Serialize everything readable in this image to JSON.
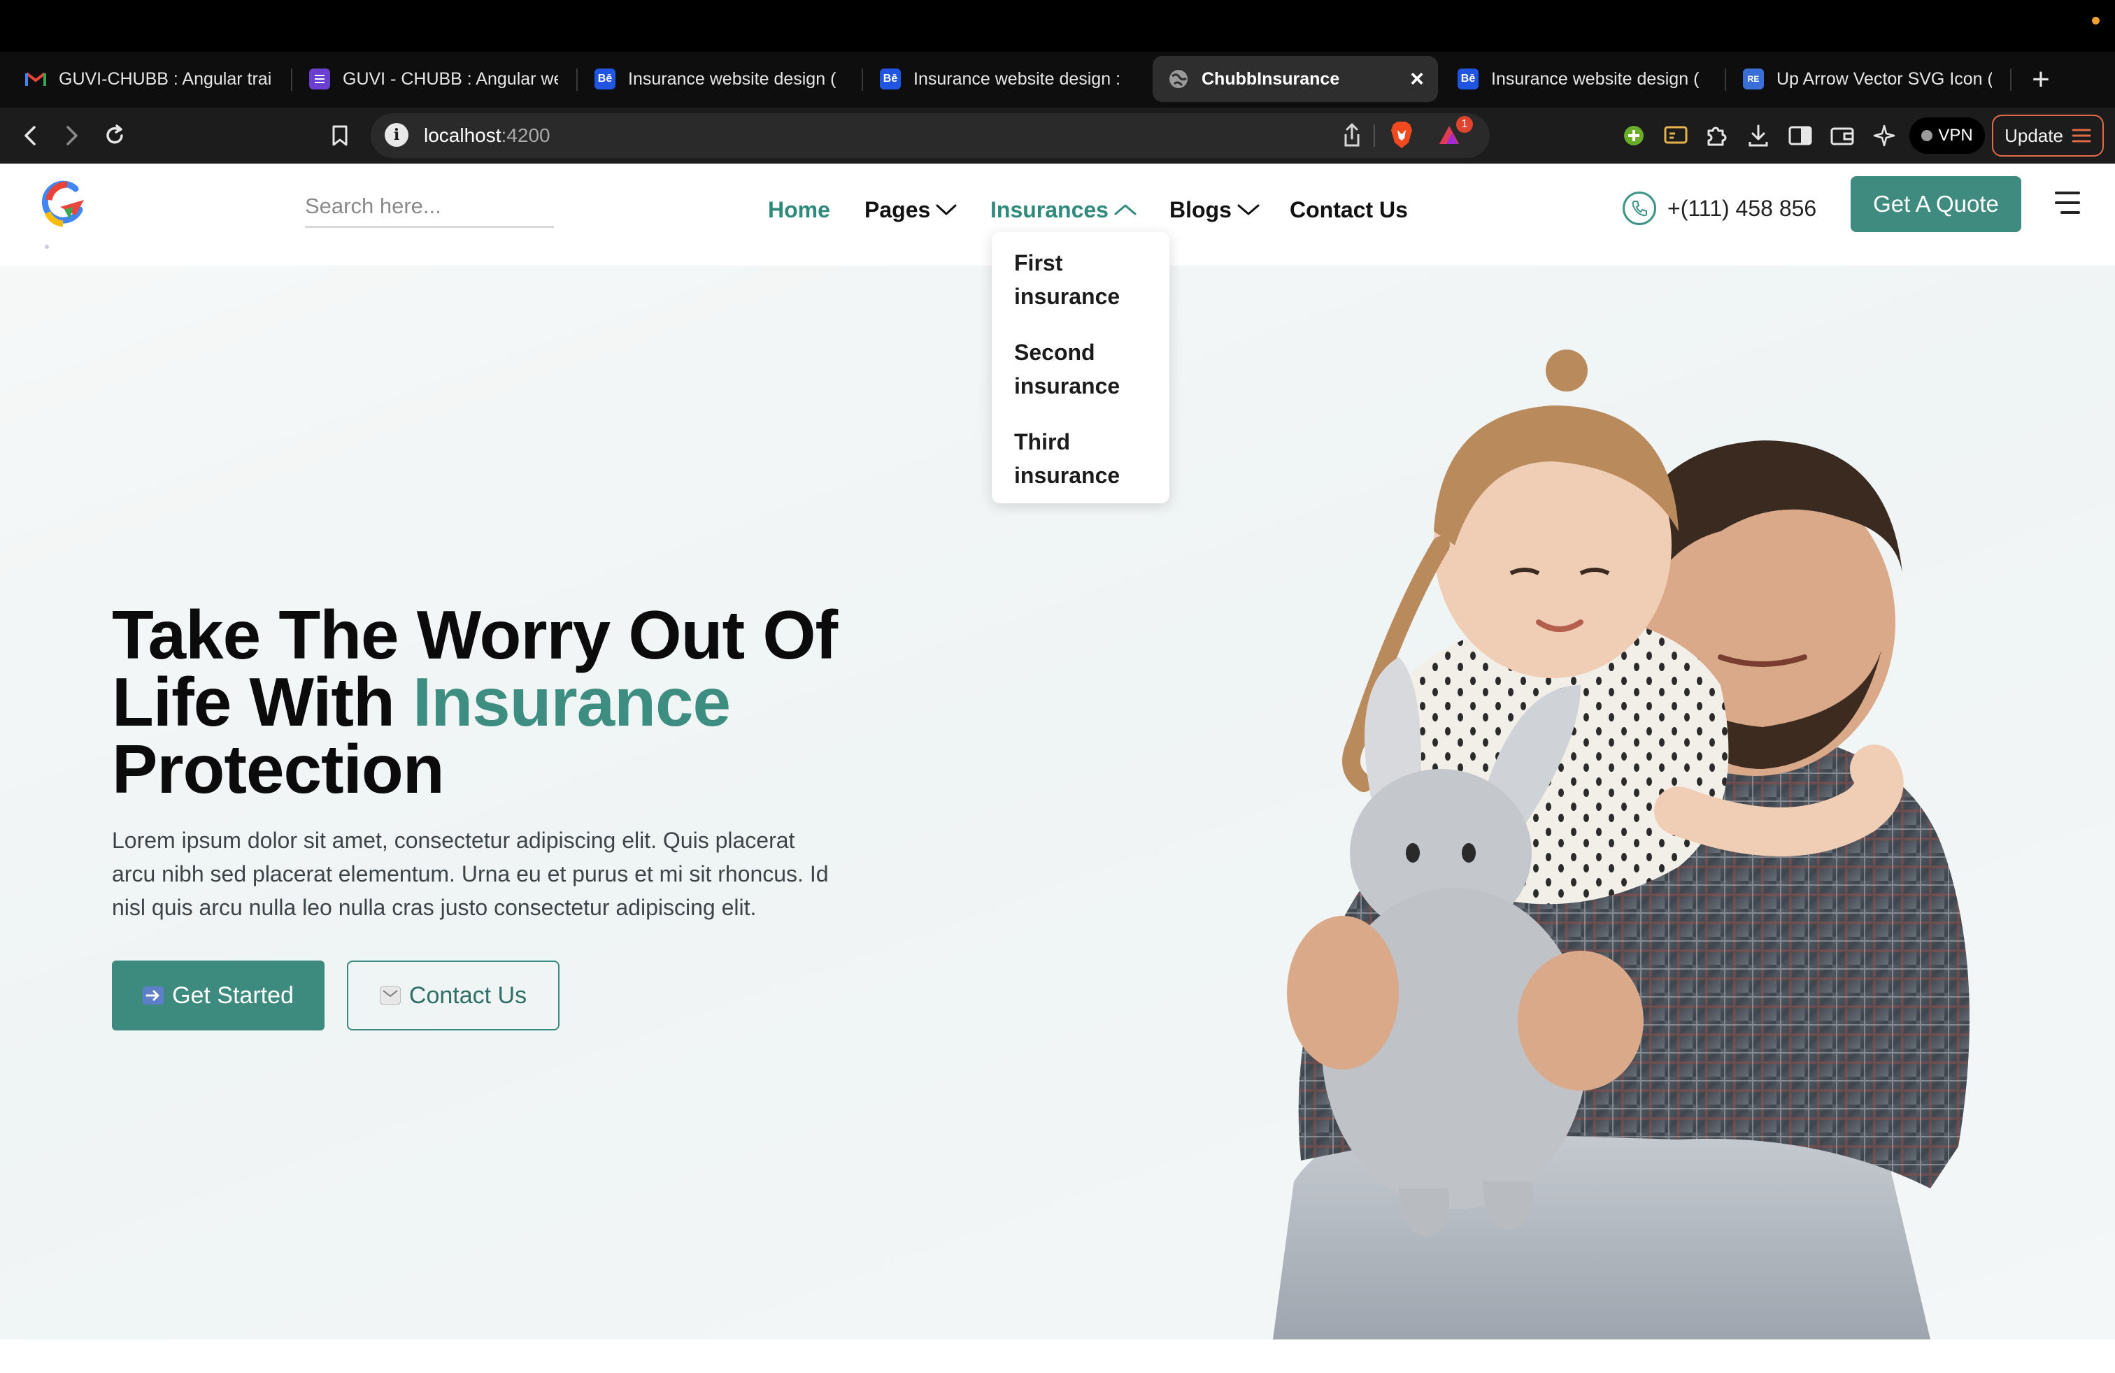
{
  "browser": {
    "tabs": [
      {
        "label": "GUVI-CHUBB : Angular trai",
        "favicon": "gmail-icon"
      },
      {
        "label": "GUVI - CHUBB : Angular we",
        "favicon": "forms-icon"
      },
      {
        "label": "Insurance website design (",
        "favicon": "behance-icon"
      },
      {
        "label": "Insurance website design :",
        "favicon": "behance-icon"
      },
      {
        "label": "ChubbInsurance",
        "favicon": "globe-icon",
        "active": true
      },
      {
        "label": "Insurance website design (",
        "favicon": "behance-icon"
      },
      {
        "label": "Up Arrow Vector SVG Icon (",
        "favicon": "svgrepo-icon"
      }
    ],
    "favicon_text": {
      "behance": "Bē",
      "svgrepo": "RE"
    },
    "close_glyph": "×",
    "new_tab_glyph": "+",
    "url_host": "localhost",
    "url_port": ":4200",
    "info_glyph": "i",
    "brave_badge_count": "1",
    "vpn_label": "VPN",
    "update_label": "Update"
  },
  "header": {
    "search_placeholder": "Search here...",
    "nav": {
      "home": "Home",
      "pages": "Pages",
      "insurances": "Insurances",
      "blogs": "Blogs",
      "contact": "Contact Us"
    },
    "phone": "+(111) 458 856",
    "quote_label": "Get A Quote"
  },
  "dropdown": {
    "items": [
      "First insurance",
      "Second insurance",
      "Third insurance"
    ]
  },
  "hero": {
    "title_line1": "Take The Worry Out Of",
    "title_line2_prefix": "Life With ",
    "title_accent": "Insurance",
    "title_line3": "Protection",
    "description": "Lorem ipsum dolor sit amet, consectetur adipiscing elit. Quis placerat arcu nibh sed placerat elementum. Urna eu et purus et mi sit rhoncus. Id nisl quis arcu nulla leo nulla cras justo consectetur adipiscing elit.",
    "get_started": "Get Started",
    "contact_us": "Contact Us"
  },
  "colors": {
    "brand_teal": "#3d8a7e",
    "nav_active": "#2f8a7c",
    "text_dark": "#0b0b0b",
    "hero_bg": "#f2f6f6"
  }
}
